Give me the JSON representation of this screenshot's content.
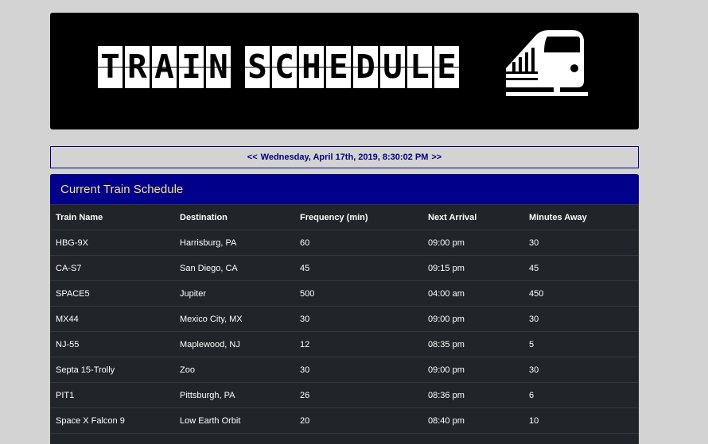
{
  "banner": {
    "title_letters": [
      "T",
      "R",
      "A",
      "I",
      "N",
      " ",
      "S",
      "C",
      "H",
      "E",
      "D",
      "U",
      "L",
      "E"
    ],
    "icon": "train-icon"
  },
  "clock": {
    "prev": "<<",
    "text": "Wednesday, April 17th, 2019, 8:30:02 PM",
    "next": ">>"
  },
  "schedule": {
    "heading": "Current Train Schedule",
    "columns": [
      "Train Name",
      "Destination",
      "Frequency (min)",
      "Next Arrival",
      "Minutes Away"
    ],
    "rows": [
      [
        "HBG-9X",
        "Harrisburg, PA",
        "60",
        "09:00 pm",
        "30"
      ],
      [
        "CA-S7",
        "San Diego, CA",
        "45",
        "09:15 pm",
        "45"
      ],
      [
        "SPACE5",
        "Jupiter",
        "500",
        "04:00 am",
        "450"
      ],
      [
        "MX44",
        "Mexico City, MX",
        "30",
        "09:00 pm",
        "30"
      ],
      [
        "NJ-55",
        "Maplewood, NJ",
        "12",
        "08:35 pm",
        "5"
      ],
      [
        "Septa 15-Trolly",
        "Zoo",
        "30",
        "09:00 pm",
        "30"
      ],
      [
        "PIT1",
        "Pittsburgh, PA",
        "26",
        "08:36 pm",
        "6"
      ],
      [
        "Space X Falcon 9",
        "Low Earth Orbit",
        "20",
        "08:40 pm",
        "10"
      ]
    ]
  },
  "colors": {
    "page_bg": "#d3d3d3",
    "heading_bg": "#00008b",
    "heading_text": "#f7e27a",
    "table_bg": "#212529",
    "clock_text": "#000080"
  }
}
